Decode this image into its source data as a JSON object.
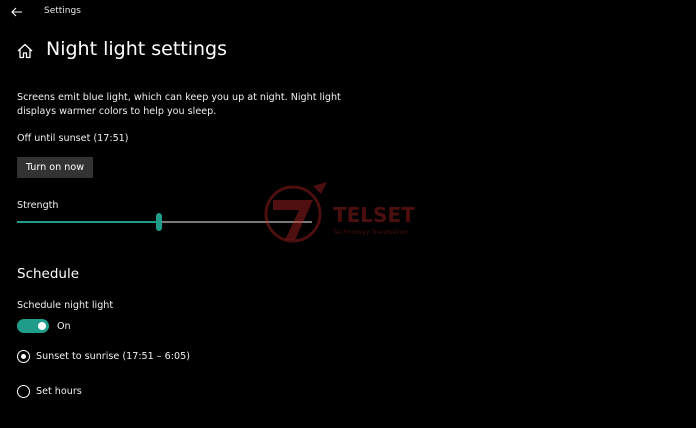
{
  "window": {
    "title": "Settings",
    "back_icon": "arrow-left-icon"
  },
  "header": {
    "home_icon": "home-icon",
    "title": "Night light settings"
  },
  "description": "Screens emit blue light, which can keep you up at night. Night light displays warmer colors to help you sleep.",
  "status": "Off until sunset (17:51)",
  "turn_on_button": "Turn on now",
  "strength": {
    "label": "Strength",
    "value_fraction": 0.48
  },
  "schedule": {
    "section_title": "Schedule",
    "toggle_label": "Schedule night light",
    "toggle_state": "On",
    "toggle_on": true,
    "options": [
      {
        "label": "Sunset to sunrise (17:51 – 6:05)",
        "selected": true
      },
      {
        "label": "Set hours",
        "selected": false
      }
    ]
  },
  "colors": {
    "accent": "#1f9d8a",
    "background": "#000000",
    "button": "#333333",
    "watermark": "#c62828"
  }
}
